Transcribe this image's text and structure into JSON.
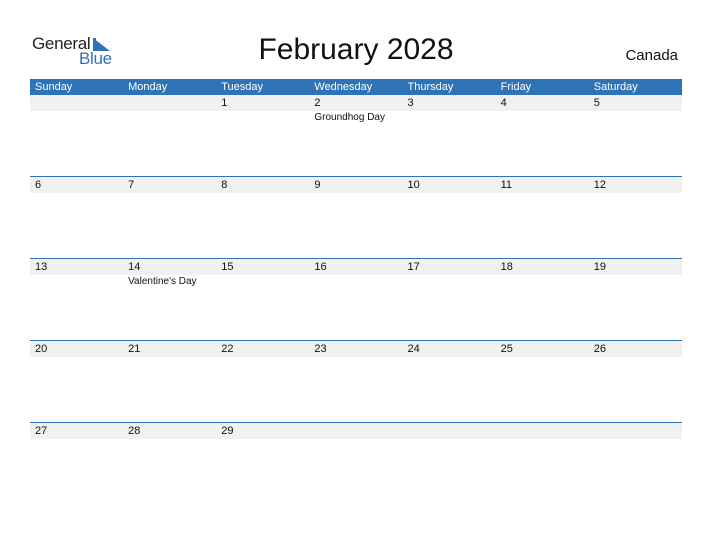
{
  "logo": {
    "general": "General",
    "blue": "Blue"
  },
  "title": "February 2028",
  "country": "Canada",
  "weekdays": [
    "Sunday",
    "Monday",
    "Tuesday",
    "Wednesday",
    "Thursday",
    "Friday",
    "Saturday"
  ],
  "colors": {
    "accent": "#2f73b7",
    "date_row_bg": "#f1f1f1"
  },
  "weeks": [
    {
      "days": [
        "",
        "",
        "1",
        "2",
        "3",
        "4",
        "5"
      ],
      "events": [
        "",
        "",
        "",
        "Groundhog Day",
        "",
        "",
        ""
      ]
    },
    {
      "days": [
        "6",
        "7",
        "8",
        "9",
        "10",
        "11",
        "12"
      ],
      "events": [
        "",
        "",
        "",
        "",
        "",
        "",
        ""
      ]
    },
    {
      "days": [
        "13",
        "14",
        "15",
        "16",
        "17",
        "18",
        "19"
      ],
      "events": [
        "",
        "Valentine's Day",
        "",
        "",
        "",
        "",
        ""
      ]
    },
    {
      "days": [
        "20",
        "21",
        "22",
        "23",
        "24",
        "25",
        "26"
      ],
      "events": [
        "",
        "",
        "",
        "",
        "",
        "",
        ""
      ]
    },
    {
      "days": [
        "27",
        "28",
        "29",
        "",
        "",
        "",
        ""
      ],
      "events": [
        "",
        "",
        "",
        "",
        "",
        "",
        ""
      ]
    }
  ]
}
